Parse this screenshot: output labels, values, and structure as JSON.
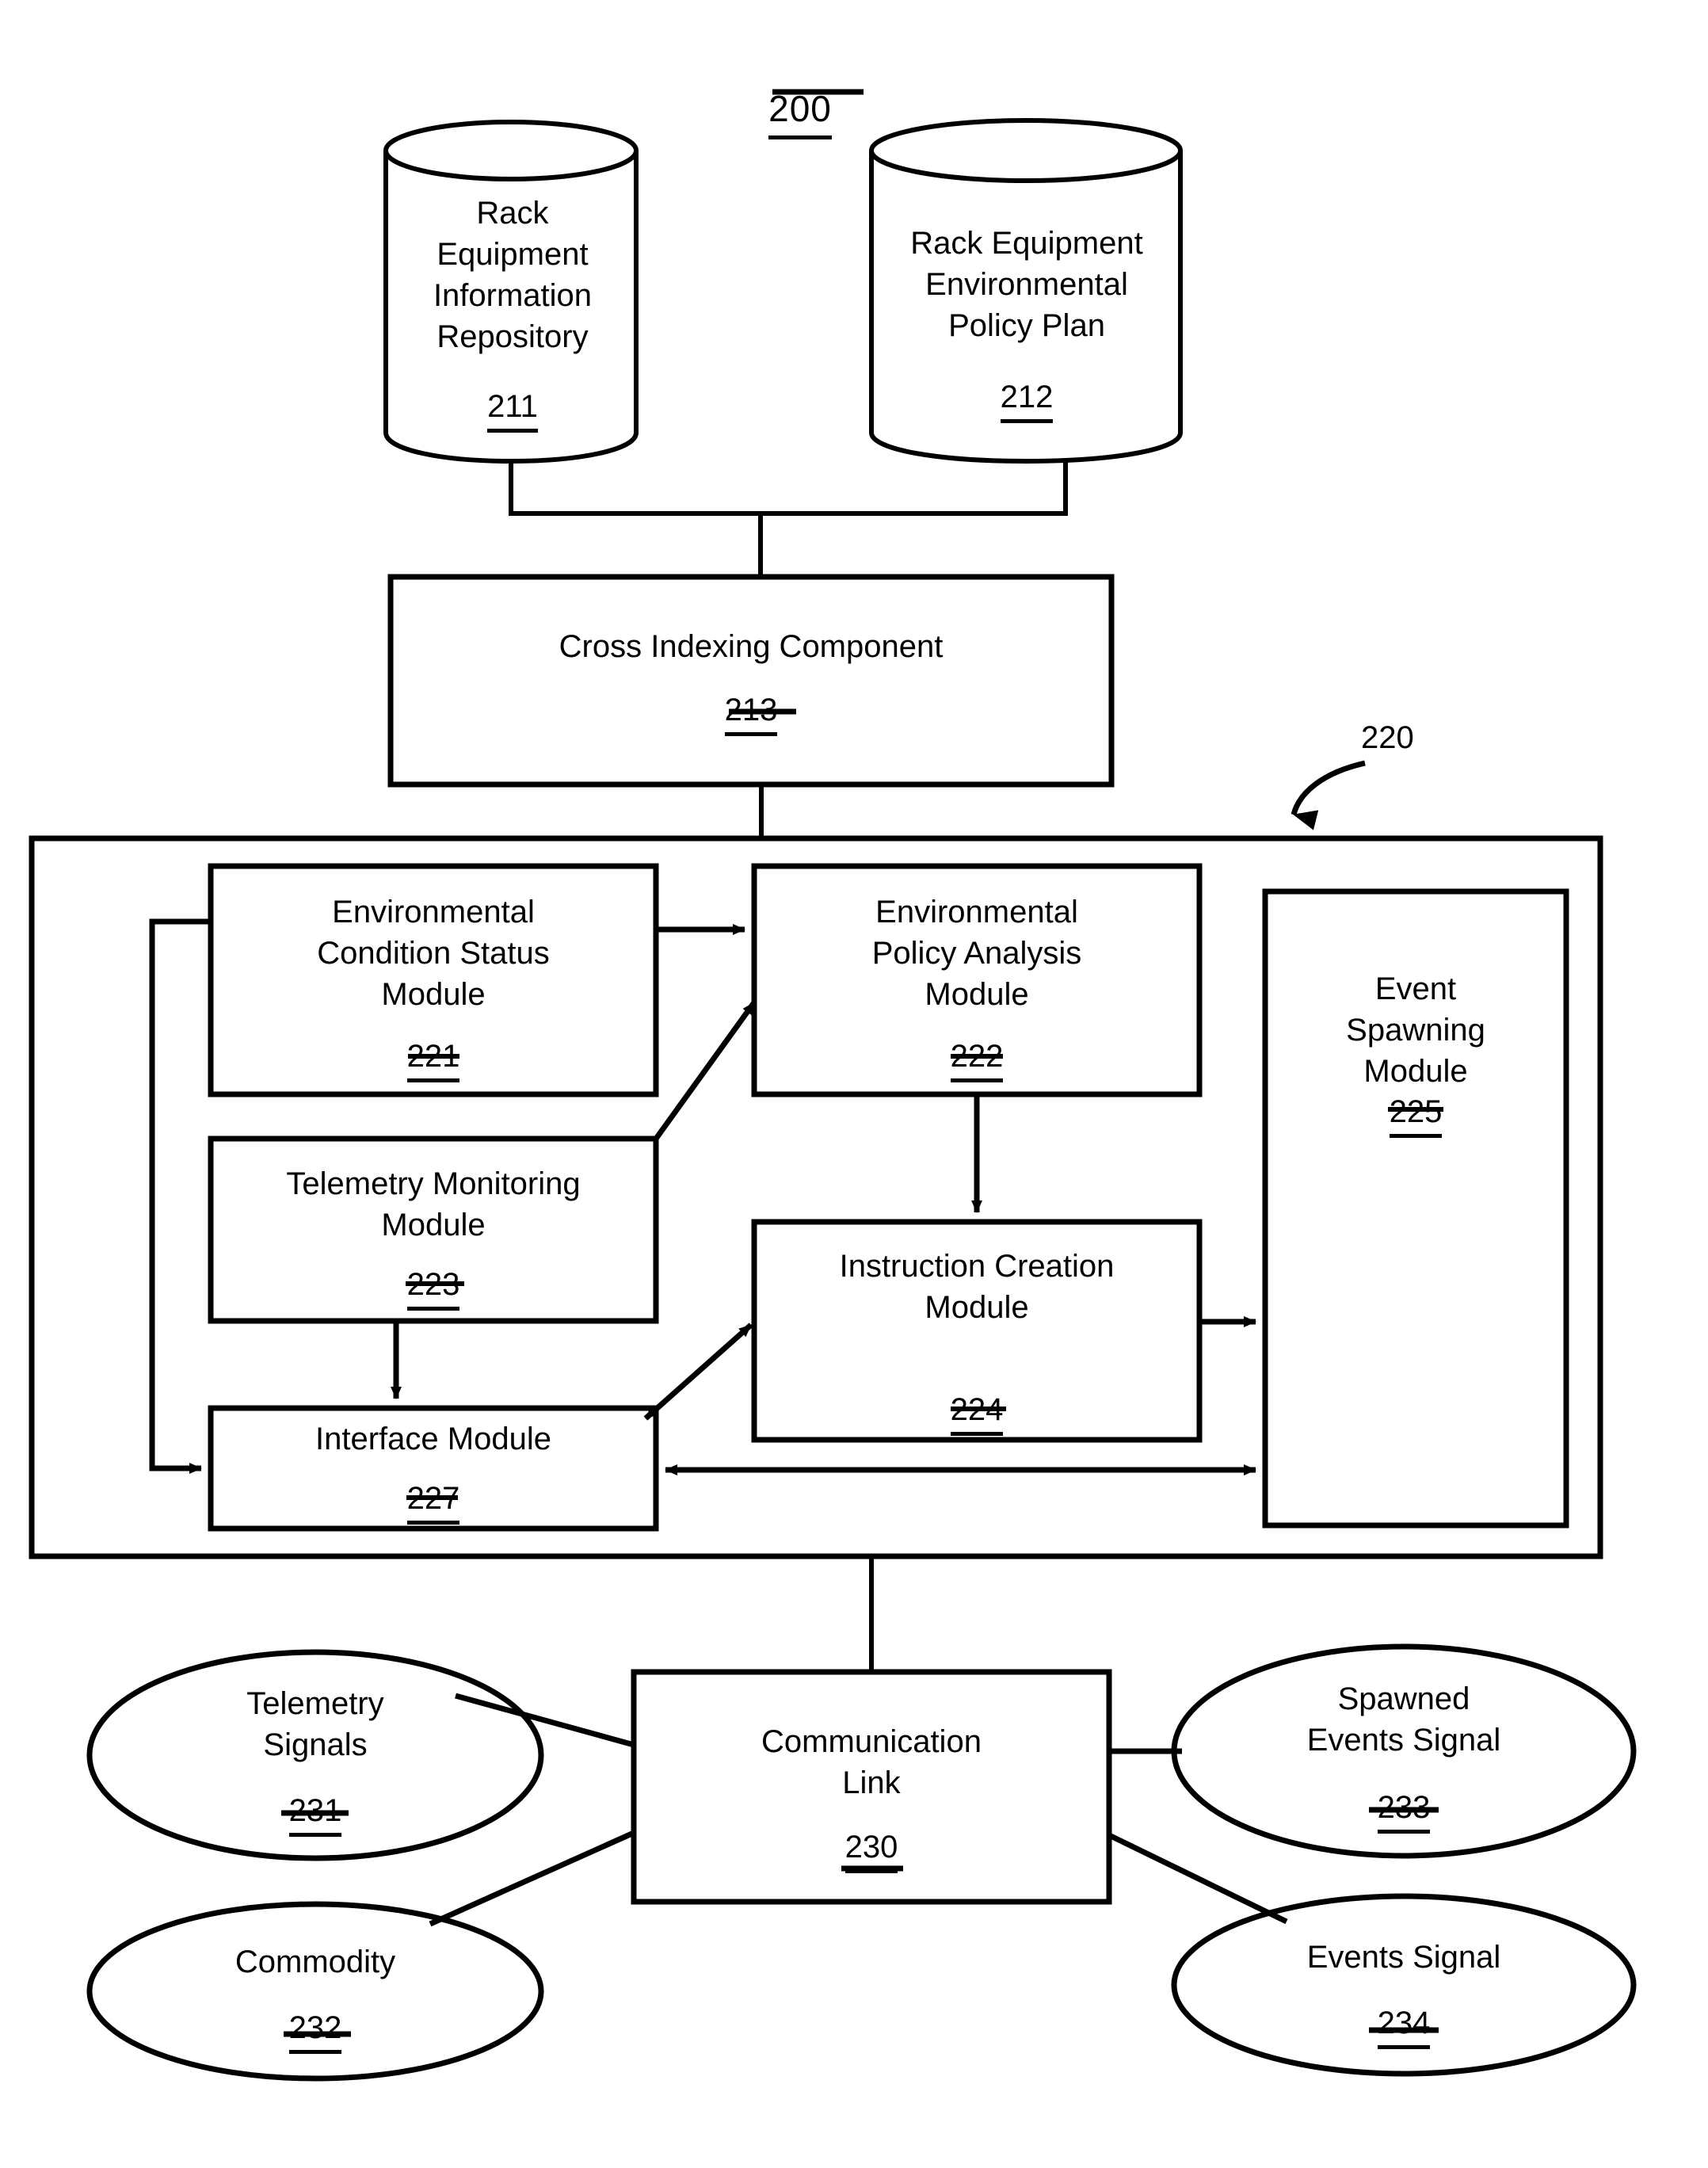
{
  "figure": {
    "number": "200",
    "type": "patent-block-diagram"
  },
  "nodes": {
    "repository": {
      "title": "Rack\nEquipment\nInformation\nRepository",
      "ref": "211",
      "shape": "cylinder"
    },
    "policy_plan": {
      "title": "Rack Equipment\nEnvironmental\nPolicy Plan",
      "ref": "212",
      "shape": "cylinder"
    },
    "cross_indexing": {
      "title": "Cross Indexing Component",
      "ref": "213",
      "shape": "rect"
    },
    "container": {
      "ref": "220",
      "shape": "rect"
    },
    "condition_status": {
      "title": "Environmental\nCondition Status\nModule",
      "ref": "221",
      "shape": "rect"
    },
    "policy_analysis": {
      "title": "Environmental\nPolicy Analysis\nModule",
      "ref": "222",
      "shape": "rect"
    },
    "telemetry_monitoring": {
      "title": "Telemetry Monitoring\nModule",
      "ref": "223",
      "shape": "rect"
    },
    "instruction_creation": {
      "title": "Instruction Creation\nModule",
      "ref": "224",
      "shape": "rect"
    },
    "event_spawning": {
      "title": "Event\nSpawning\nModule",
      "ref": "225",
      "shape": "rect"
    },
    "interface": {
      "title": "Interface Module",
      "ref": "227",
      "shape": "rect"
    },
    "communication_link": {
      "title": "Communication\nLink",
      "ref": "230",
      "shape": "rect"
    },
    "telemetry_signals": {
      "title": "Telemetry\nSignals",
      "ref": "231",
      "shape": "ellipse"
    },
    "commodity": {
      "title": "Commodity",
      "ref": "232",
      "shape": "ellipse"
    },
    "spawned_events_signal": {
      "title": "Spawned\nEvents Signal",
      "ref": "233",
      "shape": "ellipse"
    },
    "events_signal": {
      "title": "Events Signal",
      "ref": "234",
      "shape": "ellipse"
    }
  },
  "colors": {
    "stroke": "#000000",
    "background": "#ffffff"
  }
}
